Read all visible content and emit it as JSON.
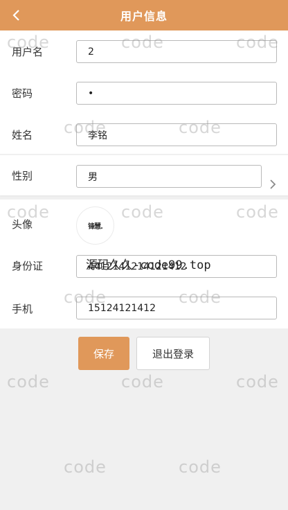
{
  "header": {
    "title": "用户信息",
    "back_icon": "chevron-left-icon"
  },
  "form": {
    "username": {
      "label": "用户名",
      "value": "2"
    },
    "password": {
      "label": "密码",
      "value": "•"
    },
    "name": {
      "label": "姓名",
      "value": "李铭"
    },
    "gender": {
      "label": "性别",
      "value": "男"
    },
    "avatar": {
      "label": "头像",
      "image_text": "锋慧."
    },
    "id_card": {
      "label": "身份证",
      "value": "4412141214121412"
    },
    "phone": {
      "label": "手机",
      "value": "15124121412"
    }
  },
  "actions": {
    "save_label": "保存",
    "logout_label": "退出登录"
  },
  "watermark": {
    "text": "code",
    "banner": "源码久久-code99.top"
  },
  "colors": {
    "accent": "#e0985a",
    "background": "#f0f0f0"
  }
}
